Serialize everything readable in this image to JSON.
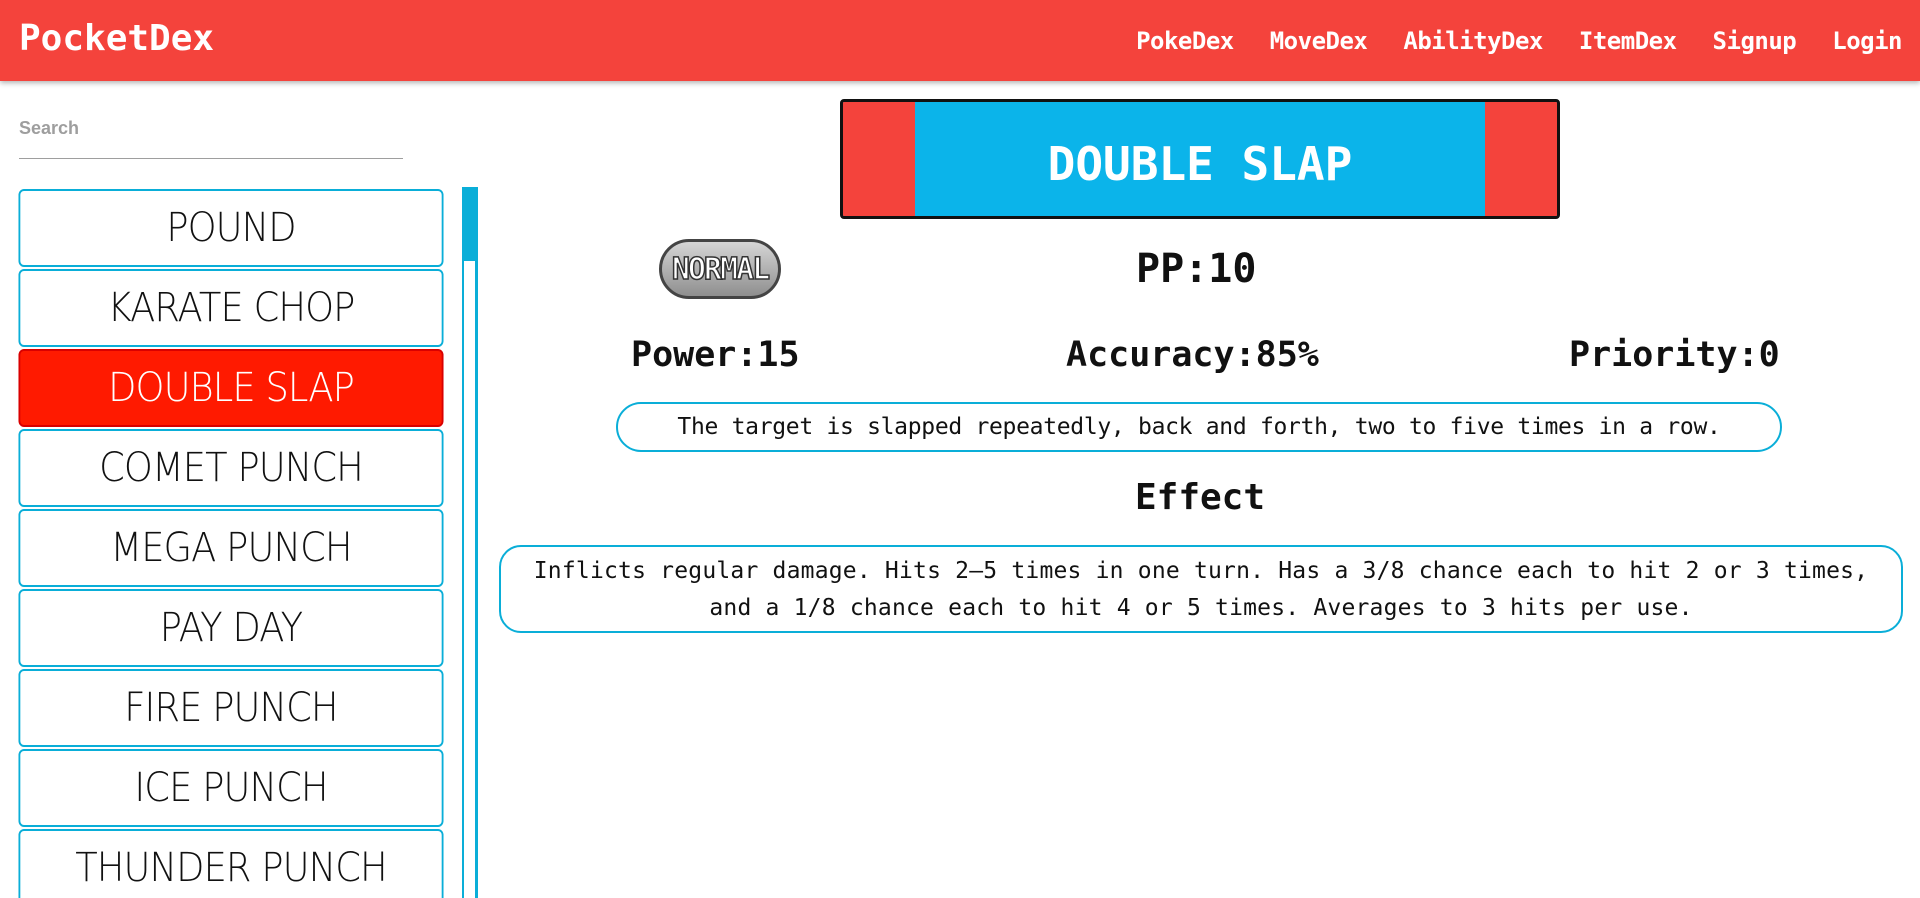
{
  "navbar": {
    "brand": "PocketDex",
    "links": [
      "PokeDex",
      "MoveDex",
      "AbilityDex",
      "ItemDex",
      "Signup",
      "Login"
    ]
  },
  "search": {
    "placeholder": "Search",
    "value": ""
  },
  "sidebar": {
    "items": [
      {
        "label": "POUND",
        "active": false
      },
      {
        "label": "KARATE CHOP",
        "active": false
      },
      {
        "label": "DOUBLE SLAP",
        "active": true
      },
      {
        "label": "COMET PUNCH",
        "active": false
      },
      {
        "label": "MEGA PUNCH",
        "active": false
      },
      {
        "label": "PAY DAY",
        "active": false
      },
      {
        "label": "FIRE PUNCH",
        "active": false
      },
      {
        "label": "ICE PUNCH",
        "active": false
      },
      {
        "label": "THUNDER PUNCH",
        "active": false
      }
    ]
  },
  "move": {
    "name": "DOUBLE SLAP",
    "type": "NORMAL",
    "pp": "PP:10",
    "power": "Power:15",
    "accuracy": "Accuracy:85%",
    "priority": "Priority:0",
    "description": "The target is slapped repeatedly, back and forth, two to five times in a row.",
    "effect_heading": "Effect",
    "effect": "Inflicts regular damage. Hits 2–5 times in one turn. Has a 3/8 chance each to hit 2 or 3 times, and a 1/8 chance each to hit 4 or 5 times. Averages to 3 hits per use."
  },
  "colors": {
    "navbar": "#f4433c",
    "accent_blue": "#0aaed8",
    "title_blue": "#0bb4ea",
    "active_item": "#ff1a00"
  }
}
